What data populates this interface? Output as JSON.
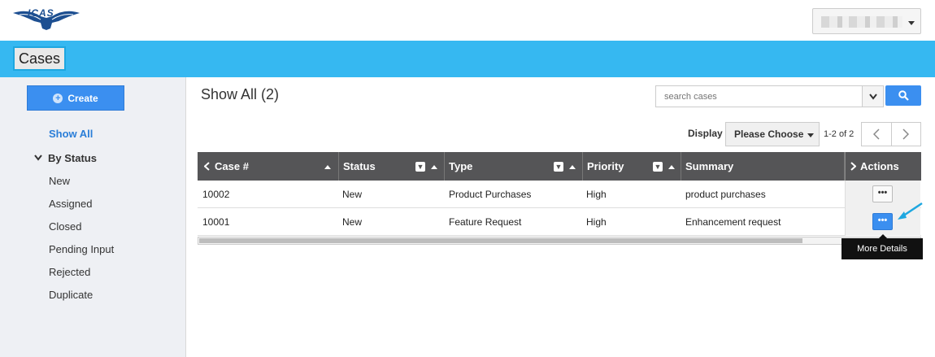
{
  "header": {
    "logo_text": "ICAS",
    "user_menu_name": ""
  },
  "page": {
    "title": "Cases"
  },
  "sidebar": {
    "create_label": "Create",
    "show_all_label": "Show All",
    "by_status_label": "By Status",
    "status_items": [
      "New",
      "Assigned",
      "Closed",
      "Pending Input",
      "Rejected",
      "Duplicate"
    ]
  },
  "main": {
    "title": "Show All (2)",
    "search_placeholder": "search cases",
    "display_label": "Display",
    "display_value": "Please Choose",
    "range_text": "1-2 of 2"
  },
  "table": {
    "columns": [
      "Case #",
      "Status",
      "Type",
      "Priority",
      "Summary",
      "Actions"
    ],
    "rows": [
      {
        "case": "10002",
        "status": "New",
        "type": "Product Purchases",
        "priority": "High",
        "summary": "product purchases"
      },
      {
        "case": "10001",
        "status": "New",
        "type": "Feature Request",
        "priority": "High",
        "summary": "Enhancement request"
      }
    ],
    "more_label": "•••"
  },
  "tooltip": {
    "text": "More Details"
  },
  "colors": {
    "accent": "#36b8f1",
    "button": "#3b8ff0",
    "header_bg": "#555557"
  }
}
